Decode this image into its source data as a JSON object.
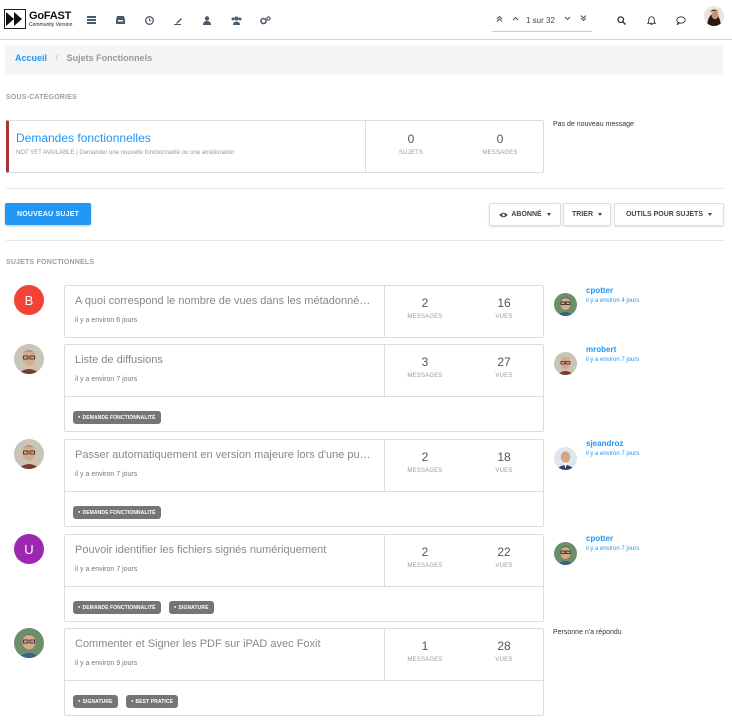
{
  "app": {
    "logo_text": "GoFAST",
    "logo_sub": "Community Version"
  },
  "pager": {
    "text": "1 sur 32"
  },
  "breadcrumb": {
    "home": "Accueil",
    "separator": "/",
    "current": "Sujets Fonctionnels"
  },
  "subcategories": {
    "heading": "SOUS-CATÉGORIES",
    "item": {
      "title": "Demandes fonctionnelles",
      "description": "NOT YET AVAILABLE | Demander une nouvelle fonctionnalité ou une amélioration",
      "topics_count": "0",
      "topics_label": "SUJETS",
      "messages_count": "0",
      "messages_label": "MESSAGES",
      "last_post": "Pas de nouveau message"
    }
  },
  "toolbar": {
    "new_topic": "NOUVEAU SUJET",
    "watch": "ABONNÉ",
    "sort": "TRIER",
    "tools": "OUTILS POUR SUJETS"
  },
  "topics_heading": "SUJETS FONCTIONNELS",
  "colors": {
    "accent": "#2196f3",
    "avatar_b": "#f44336",
    "avatar_u": "#9c27b0",
    "category_border": "#aa3333"
  },
  "topics": [
    {
      "avatar_letter": "B",
      "title": "A quoi correspond le nombre de vues dans les métadonnées ?",
      "time": "il y a environ 6 jours",
      "messages": "2",
      "views": "16",
      "tags": [],
      "last_user": "cpotter",
      "last_time": "il y a environ 4 jours"
    },
    {
      "avatar_letter": "",
      "title": "Liste de diffusions",
      "time": "il y a environ 7 jours",
      "messages": "3",
      "views": "27",
      "tags": [
        "DEMANDE FONCTIONNALITÉ"
      ],
      "last_user": "mrobert",
      "last_time": "il y a environ 7 jours"
    },
    {
      "avatar_letter": "",
      "title": "Passer automatiquement en version majeure lors d'une publication",
      "time": "il y a environ 7 jours",
      "messages": "2",
      "views": "18",
      "tags": [
        "DEMANDE FONCTIONNALITÉ"
      ],
      "last_user": "sjeandroz",
      "last_time": "il y a environ 7 jours"
    },
    {
      "avatar_letter": "U",
      "title": "Pouvoir identifier les fichiers signés numériquement",
      "time": "il y a environ 7 jours",
      "messages": "2",
      "views": "22",
      "tags": [
        "DEMANDE FONCTIONNALITÉ",
        "SIGNATURE"
      ],
      "last_user": "cpotter",
      "last_time": "il y a environ 7 jours"
    },
    {
      "avatar_letter": "",
      "title": "Commenter et Signer les PDF sur iPAD avec Foxit",
      "time": "il y a environ 9 jours",
      "messages": "1",
      "views": "28",
      "tags": [
        "SIGNATURE",
        "BEST PRATICE"
      ],
      "last_user": "",
      "last_time": "",
      "no_reply": "Personne n'a répondu"
    }
  ],
  "labels": {
    "messages": "MESSAGES",
    "views": "VUES"
  }
}
